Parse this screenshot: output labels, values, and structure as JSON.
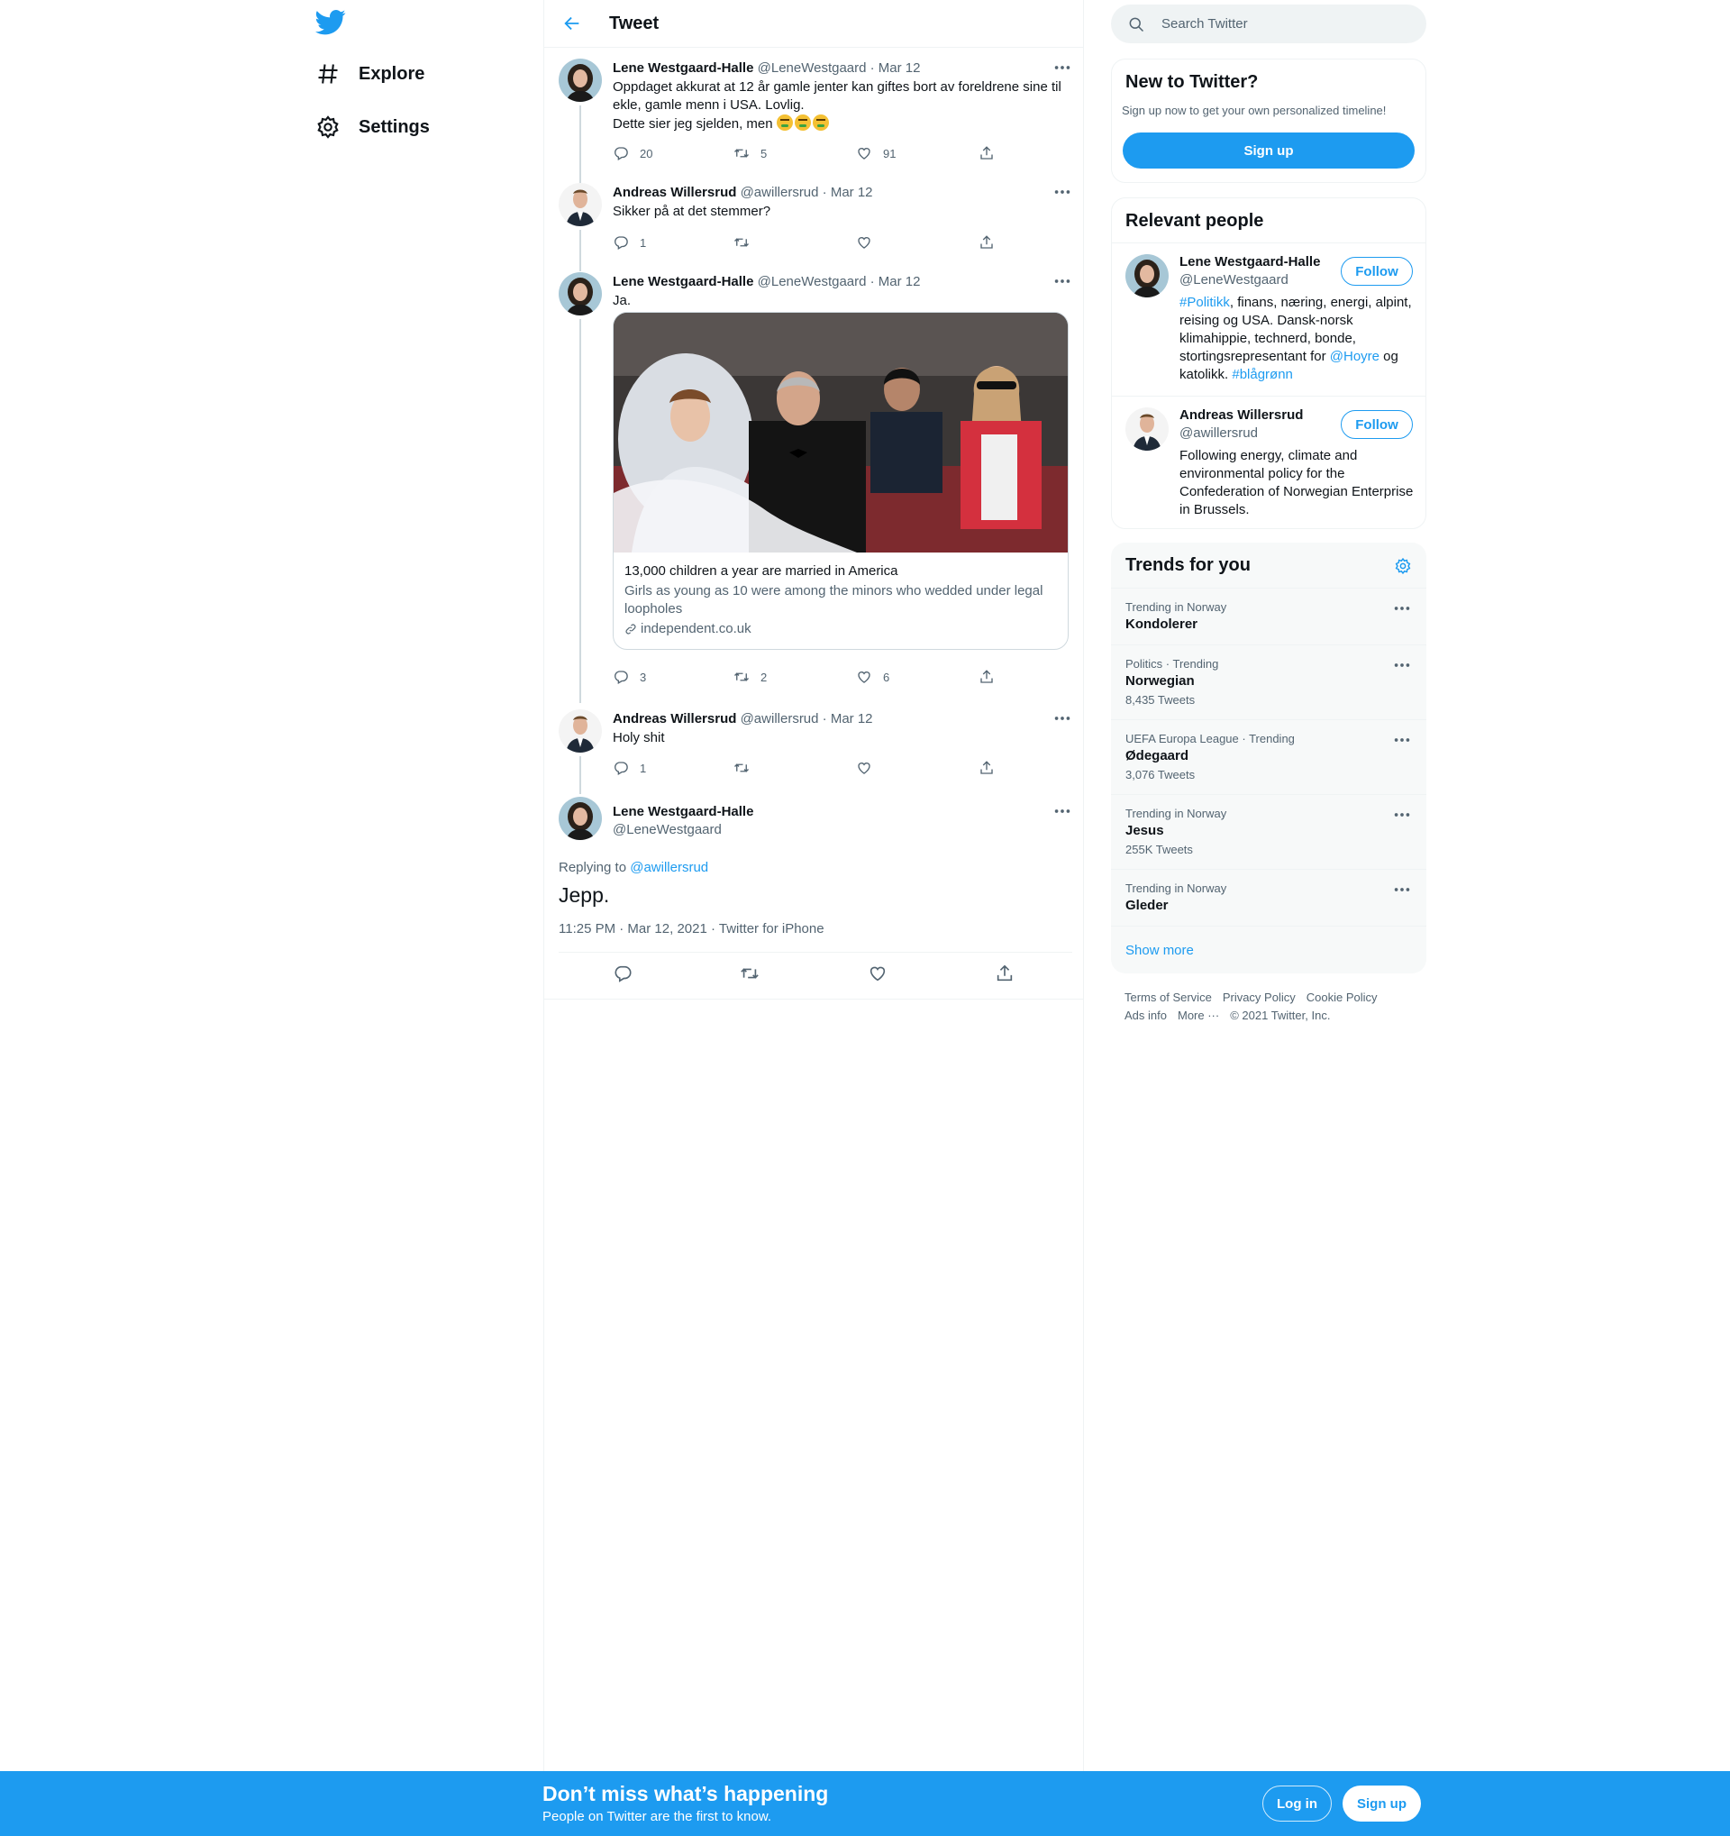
{
  "nav": {
    "explore": "Explore",
    "settings": "Settings"
  },
  "header": {
    "title": "Tweet"
  },
  "tweets": [
    {
      "author": "Lene Westgaard-Halle",
      "meta": "@LeneWestgaard · Mar 12",
      "line1": "Oppdaget akkurat at 12 år gamle jenter kan giftes bort av foreldrene sine til ekle, gamle menn i USA. Lovlig.",
      "line2": "Dette sier jeg sjelden, men",
      "replies": "20",
      "retweets": "5",
      "likes": "91"
    },
    {
      "author": "Andreas Willersrud",
      "meta": "@awillersrud · Mar 12",
      "text": "Sikker på at det stemmer?",
      "replies": "1"
    },
    {
      "author": "Lene Westgaard-Halle",
      "meta": "@LeneWestgaard · Mar 12",
      "text": "Ja.",
      "card": {
        "title": "13,000 children a year are married in America",
        "description": "Girls as young as 10 were among the minors who wedded under legal loopholes",
        "domain": "independent.co.uk"
      },
      "replies": "3",
      "retweets": "2",
      "likes": "6"
    },
    {
      "author": "Andreas Willersrud",
      "meta": "@awillersrud · Mar 12",
      "text": "Holy shit",
      "replies": "1"
    }
  ],
  "focus": {
    "author": "Lene Westgaard-Halle",
    "handle": "@LeneWestgaard",
    "replying_prefix": "Replying to ",
    "replying_to": "@awillersrud",
    "text": "Jepp.",
    "meta": "11:25 PM · Mar 12, 2021 · Twitter for iPhone"
  },
  "search": {
    "placeholder": "Search Twitter"
  },
  "new_panel": {
    "title": "New to Twitter?",
    "subtitle": "Sign up now to get your own personalized timeline!",
    "signup": "Sign up"
  },
  "people": {
    "title": "Relevant people",
    "follow": "Follow",
    "list": [
      {
        "name": "Lene Westgaard-Halle",
        "handle": "@LeneWestgaard",
        "bio_tag1": "#Politikk",
        "bio_text1": ", finans, næring, energi, alpint, reising og USA. Dansk-norsk klimahippie, technerd, bonde, stortingsrepresentant for ",
        "bio_mention": "@Hoyre",
        "bio_text2": " og katolikk. ",
        "bio_tag2": "#blågrønn"
      },
      {
        "name": "Andreas Willersrud",
        "handle": "@awillersrud",
        "bio": "Following energy, climate and environmental policy for the Confederation of Norwegian Enterprise in Brussels."
      }
    ]
  },
  "trends": {
    "title": "Trends for you",
    "items": [
      {
        "context": "Trending in Norway",
        "name": "Kondolerer",
        "count": ""
      },
      {
        "context": "Politics · Trending",
        "name": "Norwegian",
        "count": "8,435 Tweets"
      },
      {
        "context": "UEFA Europa League · Trending",
        "name": "Ødegaard",
        "count": "3,076 Tweets"
      },
      {
        "context": "Trending in Norway",
        "name": "Jesus",
        "count": "255K Tweets"
      },
      {
        "context": "Trending in Norway",
        "name": "Gleder",
        "count": ""
      }
    ],
    "show_more": "Show more"
  },
  "footer": {
    "terms": "Terms of Service",
    "privacy": "Privacy Policy",
    "cookie": "Cookie Policy",
    "ads": "Ads info",
    "more": "More ···",
    "copyright": "© 2021 Twitter, Inc."
  },
  "bottom_bar": {
    "title": "Don’t miss what’s happening",
    "subtitle": "People on Twitter are the first to know.",
    "login": "Log in",
    "signup": "Sign up"
  },
  "colors": {
    "brand": "#1d9bf0",
    "text": "#0f1419",
    "muted": "#536471"
  },
  "icons": [
    "twitter-bird-icon",
    "hashtag-icon",
    "gear-icon",
    "back-arrow-icon",
    "more-icon",
    "reply-icon",
    "retweet-icon",
    "like-icon",
    "share-icon",
    "search-icon",
    "link-icon"
  ]
}
